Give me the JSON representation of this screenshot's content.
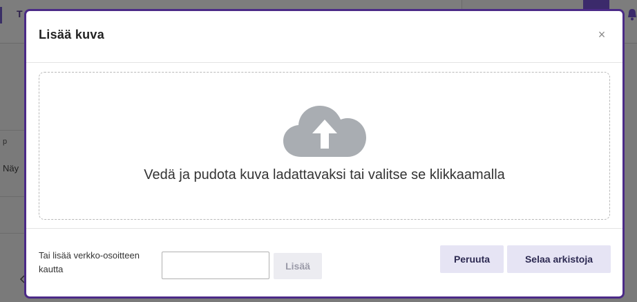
{
  "background": {
    "top_bar_text": "T",
    "side_labels": [
      "p",
      "Näy"
    ]
  },
  "modal": {
    "title": "Lisää kuva",
    "close_symbol": "×",
    "dropzone": {
      "icon": "cloud-upload-icon",
      "text": "Vedä ja pudota kuva ladattavaksi tai valitse se klikkaamalla"
    },
    "footer": {
      "url_label": "Tai lisää verkko-osoitteen kautta",
      "url_value": "",
      "add_label": "Lisää",
      "cancel_label": "Peruuta",
      "browse_label": "Selaa arkistoja"
    }
  },
  "colors": {
    "modal_border": "#4b2a87",
    "button_bg": "#e6e4f4",
    "button_text": "#2d2a52",
    "cloud_icon": "#a9adb2"
  }
}
